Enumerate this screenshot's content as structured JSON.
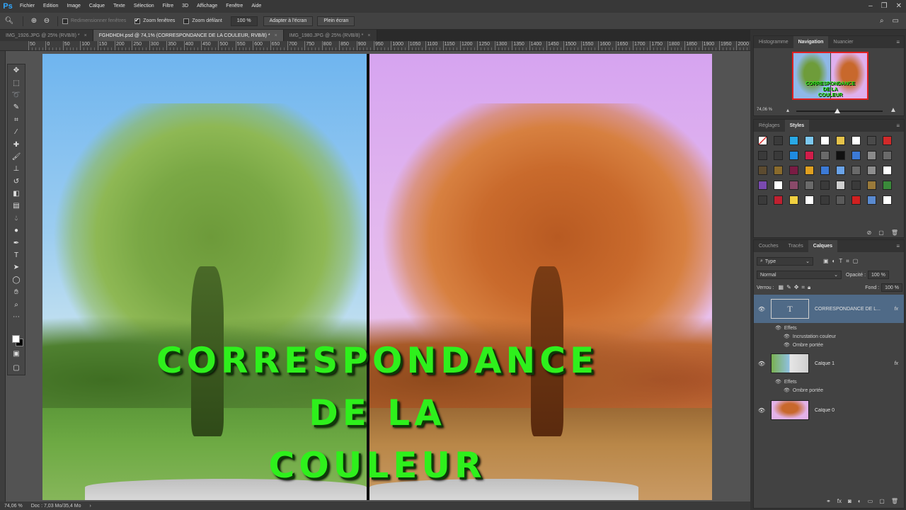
{
  "app": {
    "logo": "Ps"
  },
  "menu": [
    "Fichier",
    "Edition",
    "Image",
    "Calque",
    "Texte",
    "Sélection",
    "Filtre",
    "3D",
    "Affichage",
    "Fenêtre",
    "Aide"
  ],
  "options": {
    "resize_windows": "Redimensionner fenêtres",
    "zoom_windows": "Zoom fenêtres",
    "scroll_zoom": "Zoom défilant",
    "zoom_value": "100 %",
    "fit_screen": "Adapter à l'écran",
    "full_screen": "Plein écran"
  },
  "tabs": [
    {
      "label": "IMG_1926.JPG @ 25% (RVB/8) *",
      "active": false
    },
    {
      "label": "FGHDHDH.psd @ 74,1% (CORRESPONDANCE DE LA COULEUR, RVB/8) *",
      "active": true
    },
    {
      "label": "IMG_1980.JPG @ 25% (RVB/8) *",
      "active": false
    }
  ],
  "ruler_h": [
    "50",
    "0",
    "50",
    "100",
    "150",
    "200",
    "250",
    "300",
    "350",
    "400",
    "450",
    "500",
    "550",
    "600",
    "650",
    "700",
    "750",
    "800",
    "850",
    "900",
    "950",
    "1000",
    "1050",
    "1100",
    "1150",
    "1200",
    "1250",
    "1300",
    "1350",
    "1400",
    "1450",
    "1500",
    "1550",
    "1600",
    "1650",
    "1700",
    "1750",
    "1800",
    "1850",
    "1900",
    "1950",
    "2000"
  ],
  "canvas_text": {
    "line1": "CORRESPONDANCE",
    "line2": "DE LA",
    "line3": "COULEUR"
  },
  "status": {
    "zoom": "74,06 %",
    "doc": "Doc : 7,03 Mo/35,4 Mo"
  },
  "panels": {
    "top_tabs": [
      "Histogramme",
      "Navigation",
      "Nuancier"
    ],
    "nav_zoom": "74,06 %",
    "nav_thumb_text": [
      "CORRESPONDANCE",
      "DE LA",
      "COULEUR"
    ],
    "mid_tabs": [
      "Réglages",
      "Styles"
    ],
    "layers_tabs": [
      "Couches",
      "Tracés",
      "Calques"
    ],
    "filter_type": "Type",
    "blend_mode": "Normal",
    "opacity_label": "Opacité :",
    "opacity_value": "100 %",
    "lock_label": "Verrou :",
    "fill_label": "Fond :",
    "fill_value": "100 %"
  },
  "layers": [
    {
      "name": "CORRESPONDANCE DE L...",
      "type": "text",
      "thumb": "T",
      "fx": "fx",
      "selected": true
    },
    {
      "name": "Calque 1",
      "type": "image",
      "fx": "fx",
      "selected": false
    },
    {
      "name": "Calque 0",
      "type": "image",
      "fx": "",
      "selected": false
    }
  ],
  "effects": {
    "label": "Effets",
    "layer0_fx": [
      "Incrustation couleur",
      "Ombre portée"
    ],
    "layer1_fx": [
      "Ombre portée"
    ]
  },
  "style_colors": [
    "#ffffff",
    "#3a3a3a",
    "#29a9e6",
    "#7cc8f0",
    "#ffffff",
    "#e6c34a",
    "#ffffff",
    "#4a4a4a",
    "#d12a2a",
    "#3a3a3a",
    "#3a3a3a",
    "#1f8be0",
    "#d11d4a",
    "#6a6a6a",
    "#111111",
    "#3c7ad6",
    "#8a8a8a",
    "#6a6a6a",
    "#5c4b30",
    "#8a6b2c",
    "#7a1c44",
    "#e0a020",
    "#3c7ad6",
    "#6aa3e8",
    "#6a6a6a",
    "#8e8e8e",
    "#ffffff",
    "#7a4ab0",
    "#ffffff",
    "#8a4a6a",
    "#6a6a6a",
    "#3a3a3a",
    "#d0d0d0",
    "#3a3a3a",
    "#9a7a3a",
    "#3a8a3a",
    "#3a3a3a",
    "#c02030",
    "#f0d040",
    "#ffffff",
    "#3a3a3a",
    "#5a5a5a",
    "#d02020",
    "#5a8ad0",
    "#ffffff"
  ]
}
